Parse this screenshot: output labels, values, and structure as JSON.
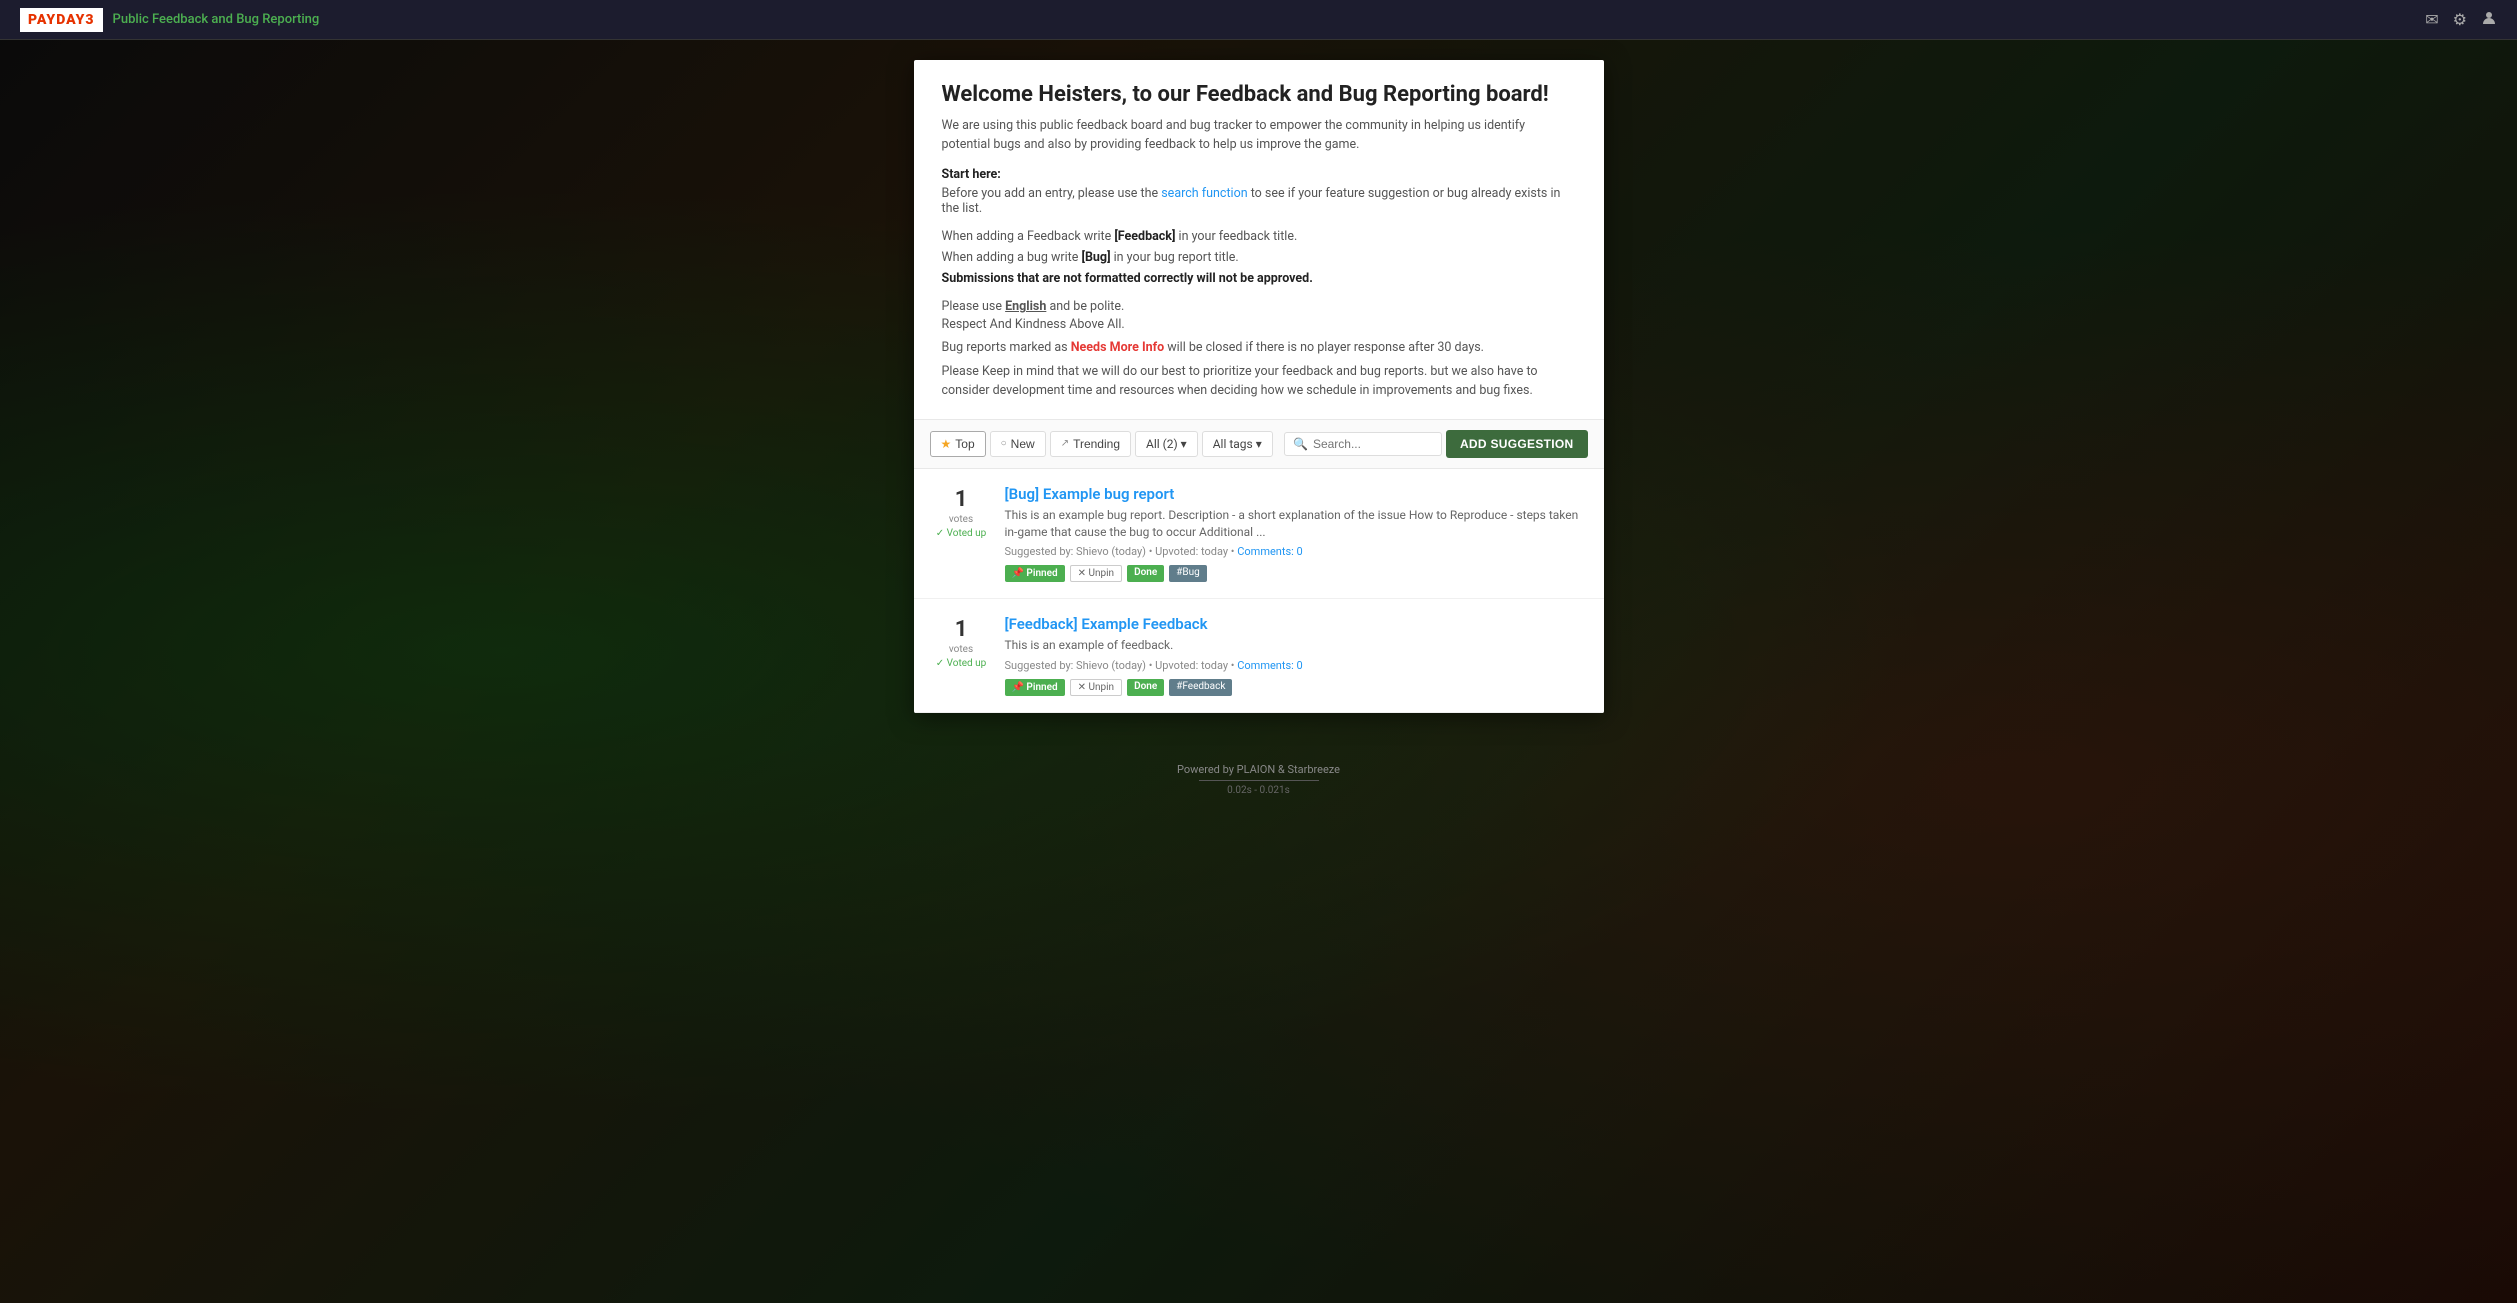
{
  "app": {
    "logo_text": "PAYDAY",
    "logo_number": "3",
    "nav_title": "Public Feedback and Bug Reporting"
  },
  "nav_icons": {
    "mail": "✉",
    "settings": "⚙",
    "user": "👤"
  },
  "welcome": {
    "title": "Welcome Heisters, to our Feedback and Bug Reporting board!",
    "description": "We are using this public feedback board and bug tracker to empower the community in helping us identify potential bugs and also by providing feedback to help us improve the game.",
    "start_here": "Start here:",
    "before_text_1": "Before you add an entry, please use the",
    "search_function": "search function",
    "before_text_2": "to see if your feature suggestion or bug already exists in the list.",
    "feedback_instruction": "When adding a Feedback write [Feedback] in your feedback title.",
    "bug_instruction": "When adding a bug write [Bug] in your bug report title.",
    "format_warning": "Submissions that are not formatted correctly will not be approved.",
    "lang_note_1": "Please use",
    "lang_english": "English",
    "lang_note_2": "and be polite.",
    "kindness_note": "Respect And Kindness Above All.",
    "nmi_text_1": "Bug reports marked as",
    "nmi_badge": "Needs More Info",
    "nmi_text_2": "will be closed if there is no player response after 30 days.",
    "consider_text": "Please Keep in mind that we will do our best to prioritize your feedback and bug reports. but we also have to consider development time and resources when deciding how we schedule in improvements and bug fixes."
  },
  "filter_bar": {
    "top_label": "Top",
    "new_label": "New",
    "trending_label": "Trending",
    "all_label": "All (2)",
    "all_tags_label": "All tags",
    "search_placeholder": "Search...",
    "add_button_label": "ADD SUGGESTION"
  },
  "posts": [
    {
      "id": "post-1",
      "vote_count": "1",
      "vote_label": "votes",
      "voted_up": "Voted up",
      "title": "[Bug] Example bug report",
      "preview": "This is an example bug report. Description - a short explanation of the issue How to Reproduce - steps taken in-game that cause the bug to occur Additional ...",
      "suggested_by": "Shievo",
      "upvoted_time": "today",
      "comments_label": "Comments: 0",
      "tags": [
        {
          "type": "pinned",
          "label": "📌 Pinned"
        },
        {
          "type": "unpin",
          "label": "✕ Unpin"
        },
        {
          "type": "done",
          "label": "Done"
        },
        {
          "type": "category",
          "label": "#Bug"
        }
      ]
    },
    {
      "id": "post-2",
      "vote_count": "1",
      "vote_label": "votes",
      "voted_up": "Voted up",
      "title": "[Feedback] Example Feedback",
      "preview": "This is an example of feedback.",
      "suggested_by": "Shievo",
      "upvoted_time": "today",
      "comments_label": "Comments: 0",
      "tags": [
        {
          "type": "pinned",
          "label": "📌 Pinned"
        },
        {
          "type": "unpin",
          "label": "✕ Unpin"
        },
        {
          "type": "done",
          "label": "Done"
        },
        {
          "type": "feedback",
          "label": "#Feedback"
        }
      ]
    }
  ],
  "footer": {
    "powered_by": "Powered by PLAION & Starbreeze",
    "timing": "0.02s - 0.021s"
  }
}
